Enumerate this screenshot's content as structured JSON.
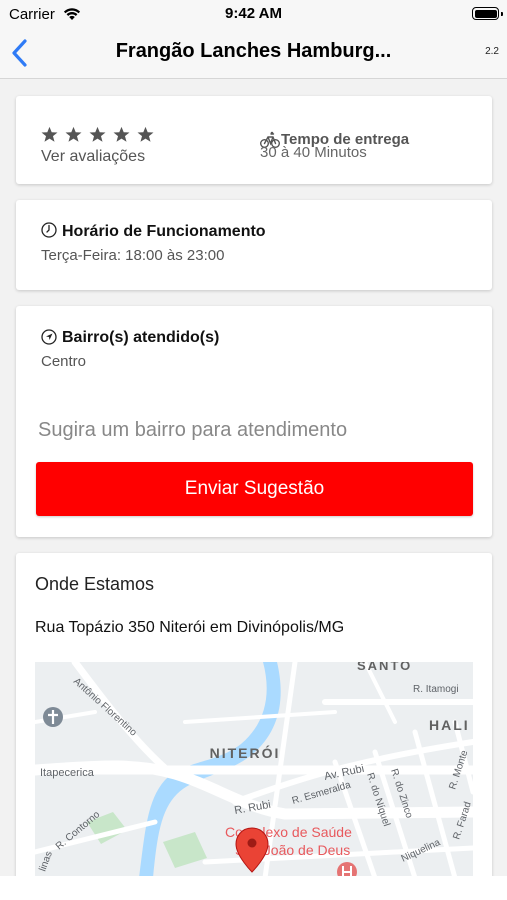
{
  "status_bar": {
    "carrier": "Carrier",
    "time": "9:42 AM"
  },
  "nav": {
    "title": "Frangão Lanches Hamburg...",
    "version": "2.2"
  },
  "rating": {
    "stars": 5,
    "link_label": "Ver avaliações"
  },
  "delivery": {
    "title": "Tempo de entrega",
    "time": "30 à 40 Minutos"
  },
  "hours": {
    "title": "Horário de Funcionamento",
    "schedule": "Terça-Feira: 18:00 às 23:00"
  },
  "bairro": {
    "title": "Bairro(s) atendido(s)",
    "neighborhood": "Centro",
    "suggest_placeholder": "Sugira um bairro para atendimento",
    "send_label": "Enviar Sugestão"
  },
  "location": {
    "title": "Onde Estamos",
    "address": "Rua Topázio 350 Niterói em Divinópolis/MG"
  },
  "map": {
    "district_label": "NITERÓI",
    "district_label_right": "HALI",
    "district_label_top": "SANTO",
    "streets": [
      "Antônio Florentino",
      "Itapecerica",
      "Av. Rubi",
      "R. Rubi",
      "R. Esmeralda",
      "R. do Níquel",
      "R. do Zinco",
      "R. Itamogi",
      "R. Contorno",
      "R. Monte",
      "R. Farad",
      "Niquelina",
      "linas"
    ],
    "poi": "Complexo de Saúde São João de Deus",
    "colors": {
      "water": "#aadaff",
      "park": "#c8e6c9",
      "road": "#ffffff",
      "pin": "#ea4335"
    }
  },
  "colors": {
    "accent": "#ff0000",
    "ios_blue": "#2f7bf6"
  }
}
